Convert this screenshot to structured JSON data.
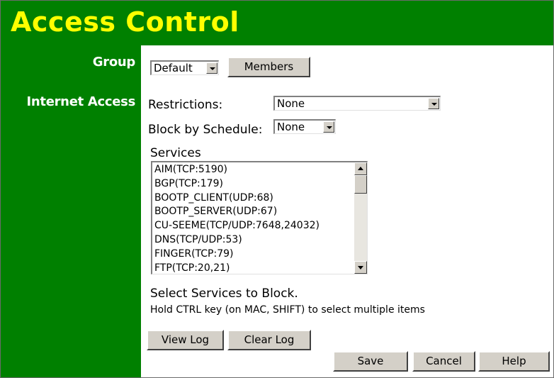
{
  "header": {
    "title": "Access Control"
  },
  "sidebar": {
    "group_label": "Group",
    "internet_access_label": "Internet Access"
  },
  "group": {
    "selected": "Default",
    "members_button": "Members"
  },
  "internet_access": {
    "restrictions_label": "Restrictions:",
    "restrictions_value": "None",
    "schedule_label": "Block by Schedule:",
    "schedule_value": "None",
    "services_label": "Services",
    "services": [
      "AIM(TCP:5190)",
      "BGP(TCP:179)",
      "BOOTP_CLIENT(UDP:68)",
      "BOOTP_SERVER(UDP:67)",
      "CU-SEEME(TCP/UDP:7648,24032)",
      "DNS(TCP/UDP:53)",
      "FINGER(TCP:79)",
      "FTP(TCP:20,21)"
    ],
    "select_hint": "Select Services to Block.",
    "ctrl_hint": "Hold CTRL key (on MAC, SHIFT) to select multiple items"
  },
  "buttons": {
    "view_log": "View Log",
    "clear_log": "Clear Log",
    "save": "Save",
    "cancel": "Cancel",
    "help": "Help"
  },
  "colors": {
    "brand_green": "#008000",
    "title_yellow": "#ffff00",
    "button_face": "#d4d0c8"
  },
  "icons": {
    "dropdown": "chevron-down-icon",
    "scroll_up": "arrow-up-icon",
    "scroll_down": "arrow-down-icon"
  }
}
